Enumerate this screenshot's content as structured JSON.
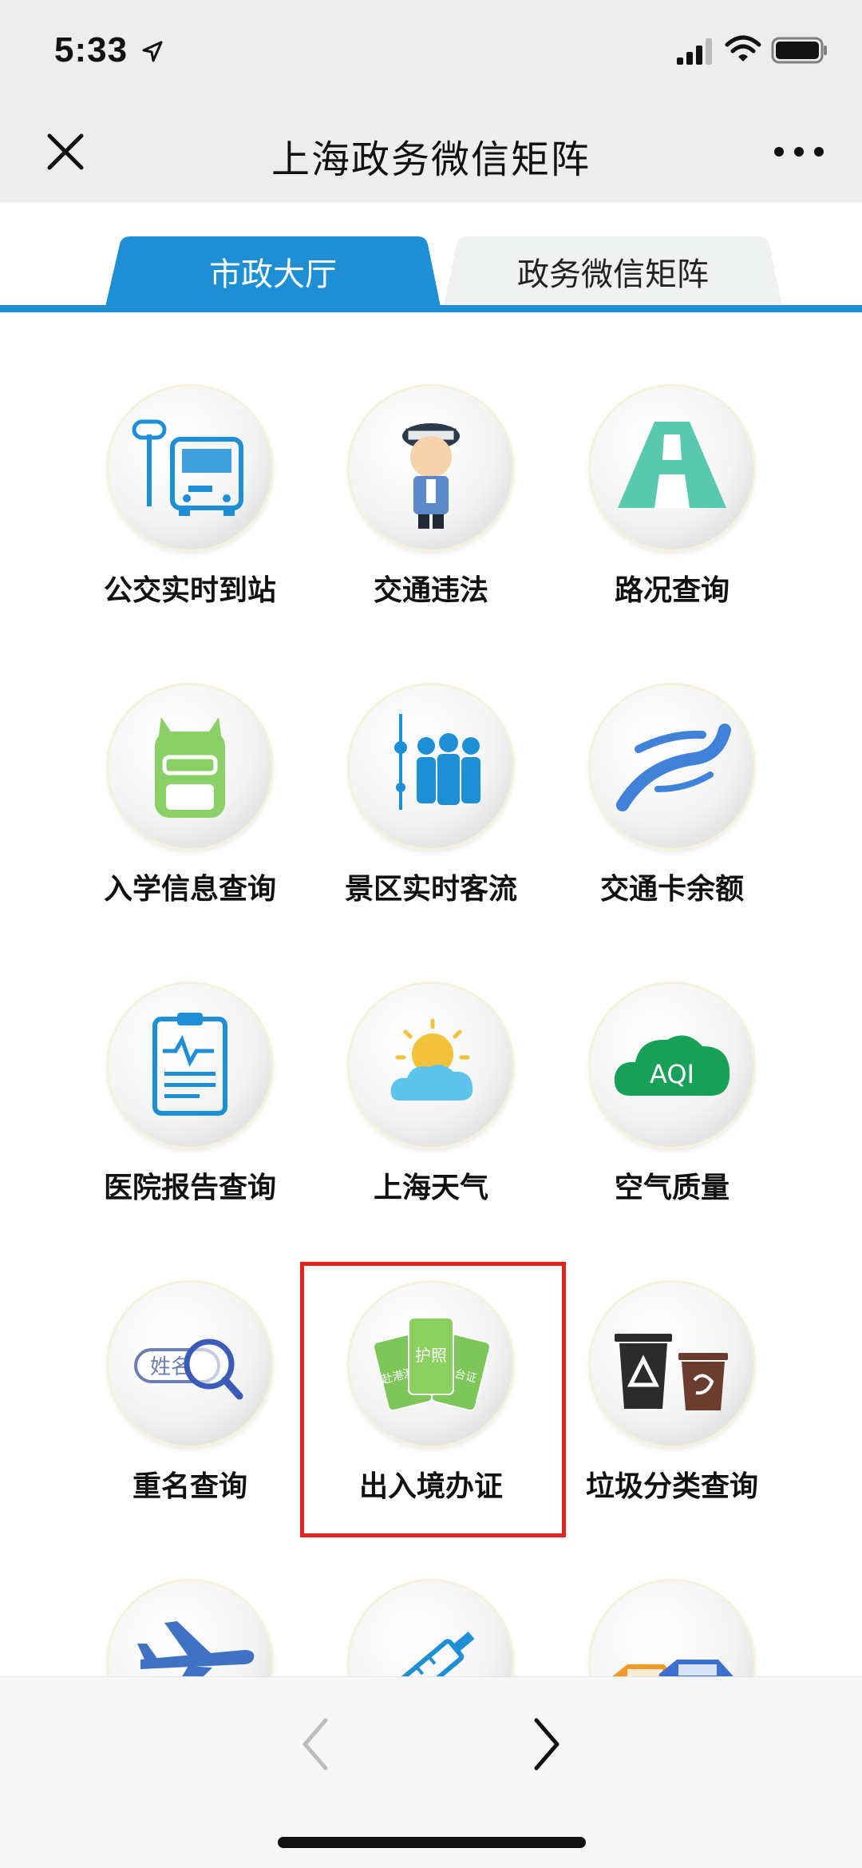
{
  "status_bar": {
    "time": "5:33"
  },
  "header": {
    "title": "上海政务微信矩阵"
  },
  "tabs": [
    {
      "label": "市政大厅",
      "active": true
    },
    {
      "label": "政务微信矩阵",
      "active": false
    }
  ],
  "services": [
    {
      "label": "公交实时到站",
      "icon": "bus-stop-icon"
    },
    {
      "label": "交通违法",
      "icon": "traffic-police-icon"
    },
    {
      "label": "路况查询",
      "icon": "road-icon"
    },
    {
      "label": "入学信息查询",
      "icon": "school-bag-icon"
    },
    {
      "label": "景区实时客流",
      "icon": "crowd-tower-icon"
    },
    {
      "label": "交通卡余额",
      "icon": "transport-card-icon"
    },
    {
      "label": "医院报告查询",
      "icon": "medical-report-icon"
    },
    {
      "label": "上海天气",
      "icon": "weather-icon"
    },
    {
      "label": "空气质量",
      "icon": "air-quality-icon"
    },
    {
      "label": "重名查询",
      "icon": "name-search-icon"
    },
    {
      "label": "出入境办证",
      "icon": "passport-cards-icon"
    },
    {
      "label": "垃圾分类查询",
      "icon": "trash-bins-icon"
    },
    {
      "label": "",
      "icon": "airplane-icon"
    },
    {
      "label": "",
      "icon": "syringe-icon"
    },
    {
      "label": "",
      "icon": "cars-icon"
    }
  ],
  "icon_text": {
    "name_search": "姓名",
    "aqi": "AQI",
    "card_left": "赴港澳证",
    "card_center": "护照",
    "card_right": "赴台证"
  },
  "colors": {
    "accent_blue": "#1e8fd5",
    "highlight_red": "#e0241c",
    "card_green": "#7cc65a"
  }
}
